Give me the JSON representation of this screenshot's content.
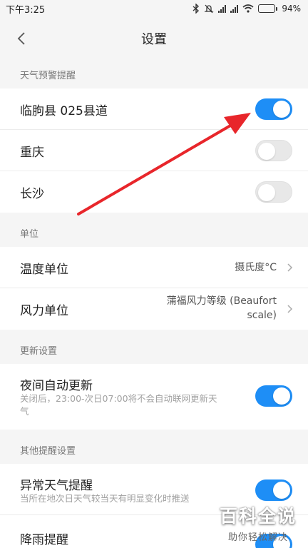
{
  "status": {
    "time": "下午3:25",
    "battery": "94%",
    "battery_level": 0.94
  },
  "nav": {
    "title": "设置"
  },
  "sections": {
    "weather_warning": {
      "header": "天气预警提醒",
      "items": [
        {
          "label": "临朐县 025县道",
          "on": true
        },
        {
          "label": "重庆",
          "on": false
        },
        {
          "label": "长沙",
          "on": false
        }
      ]
    },
    "units": {
      "header": "单位",
      "temperature": {
        "label": "温度单位",
        "value": "摄氏度°C"
      },
      "wind": {
        "label": "风力单位",
        "value_line1": "蒲福风力等级 (Beaufort",
        "value_line2": "scale)"
      }
    },
    "update": {
      "header": "更新设置",
      "night": {
        "label": "夜间自动更新",
        "desc_line1": "关闭后，23:00-次日07:00将不会自动联网更新天",
        "desc_line2": "气",
        "on": true
      }
    },
    "other": {
      "header": "其他提醒设置",
      "abnormal": {
        "label": "异常天气提醒",
        "desc": "当所在地次日天气较当天有明显变化时推送",
        "on": true
      },
      "rain": {
        "label": "降雨提醒",
        "on": true
      }
    }
  },
  "watermark": {
    "main": "百科全说",
    "sub": "助你轻松解决"
  },
  "colors": {
    "toggle_on": "#1e8ef6",
    "arrow": "#e8262b"
  }
}
